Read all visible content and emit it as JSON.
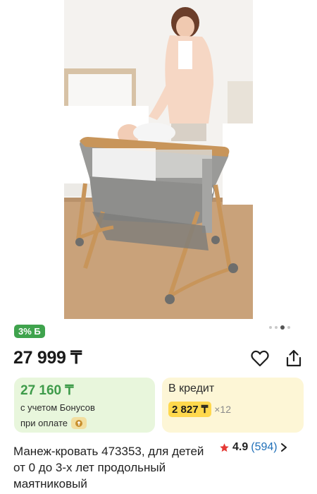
{
  "product": {
    "image_alt": "Манеж-кровать",
    "discount_badge": "3% Б",
    "price": "27 999 ₸",
    "title": "Манеж-кровать 473353, для детей от 0 до 3-х лет продольный маятниковый",
    "rating": {
      "score": "4.9",
      "count": "(594)"
    }
  },
  "carousel": {
    "total": 4,
    "active": 3
  },
  "bonus": {
    "price": "27 160 ₸",
    "line1": "с учетом Бонусов",
    "line2": "при оплате"
  },
  "credit": {
    "title": "В кредит",
    "amount": "2 827 ₸",
    "multiplier": "×12"
  },
  "colors": {
    "green_badge": "#3fa34d",
    "bonus_green": "#3e9b4a",
    "bonus_bg": "#e8f6dc",
    "credit_bg": "#fdf6d6",
    "credit_amount_bg": "#ffd84d",
    "link_blue": "#1f6fb8",
    "star_red": "#e53935"
  },
  "icons": [
    "heart-icon",
    "share-icon",
    "star-icon",
    "chevron-right-icon",
    "coin-icon"
  ]
}
